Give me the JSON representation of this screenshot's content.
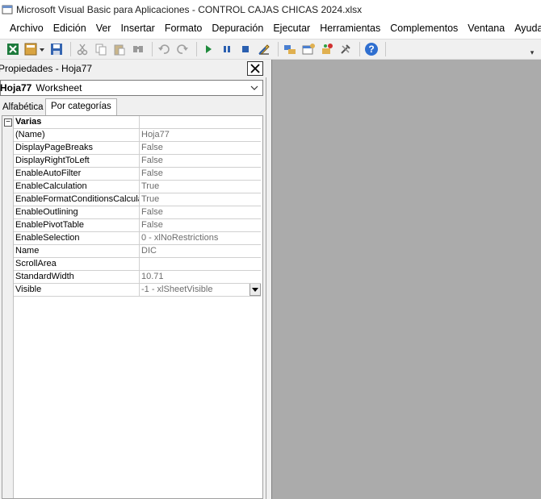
{
  "window": {
    "title": "Microsoft Visual Basic para Aplicaciones - CONTROL CAJAS CHICAS 2024.xlsx",
    "app_icon": "vba-app-icon"
  },
  "menu": [
    {
      "label": "Archivo"
    },
    {
      "label": "Edición"
    },
    {
      "label": "Ver"
    },
    {
      "label": "Insertar"
    },
    {
      "label": "Formato"
    },
    {
      "label": "Depuración"
    },
    {
      "label": "Ejecutar"
    },
    {
      "label": "Herramientas"
    },
    {
      "label": "Complementos"
    },
    {
      "label": "Ventana"
    },
    {
      "label": "Ayuda"
    }
  ],
  "toolbar": {
    "buttons": [
      "excel-icon",
      "insert-module-icon",
      "save-icon",
      "cut-icon",
      "copy-icon",
      "paste-icon",
      "find-icon",
      "undo-icon",
      "redo-icon",
      "run-icon",
      "pause-icon",
      "stop-icon",
      "design-mode-icon",
      "project-explorer-icon",
      "properties-icon",
      "object-browser-icon",
      "toolbox-icon",
      "help-icon"
    ]
  },
  "properties": {
    "title": "Propiedades - Hoja77",
    "object_name": "Hoja77",
    "object_type": "Worksheet",
    "tabs": {
      "alphabetic": "Alfabética",
      "categorized": "Por categorías"
    },
    "category": "Varias",
    "rows": [
      {
        "name": "(Name)",
        "value": "Hoja77"
      },
      {
        "name": "DisplayPageBreaks",
        "value": "False"
      },
      {
        "name": "DisplayRightToLeft",
        "value": "False"
      },
      {
        "name": "EnableAutoFilter",
        "value": "False"
      },
      {
        "name": "EnableCalculation",
        "value": "True"
      },
      {
        "name": "EnableFormatConditionsCalculation",
        "value": "True"
      },
      {
        "name": "EnableOutlining",
        "value": "False"
      },
      {
        "name": "EnablePivotTable",
        "value": "False"
      },
      {
        "name": "EnableSelection",
        "value": "0 - xlNoRestrictions"
      },
      {
        "name": "Name",
        "value": "DIC"
      },
      {
        "name": "ScrollArea",
        "value": ""
      },
      {
        "name": "StandardWidth",
        "value": "10.71"
      },
      {
        "name": "Visible",
        "value": "-1 - xlSheetVisible"
      }
    ]
  },
  "colors": {
    "workspace": "#ababab",
    "chrome": "#f0f0f0",
    "value_text": "#6d6d6d"
  }
}
